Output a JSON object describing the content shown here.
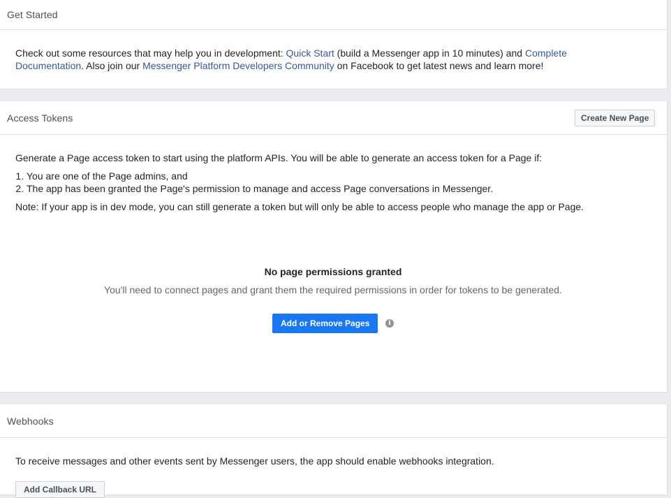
{
  "get_started": {
    "title": "Get Started",
    "text_1": "Check out some resources that may help you in development: ",
    "link_quick_start": "Quick Start",
    "text_2": " (build a Messenger app in 10 minutes) and ",
    "link_complete_line1": "Complete",
    "link_complete_line2": "Documentation",
    "text_3": ". Also join our ",
    "link_community": "Messenger Platform Developers Community",
    "text_4": " on Facebook to get latest news and learn more!"
  },
  "access_tokens": {
    "title": "Access Tokens",
    "create_page_label": "Create New Page",
    "intro": "Generate a Page access token to start using the platform APIs. You will be able to generate an access token for a Page if:",
    "steps": [
      "You are one of the Page admins, and",
      "The app has been granted the Page's permission to manage and access Page conversations in Messenger."
    ],
    "note": "Note: If your app is in dev mode, you can still generate a token but will only be able to access people who manage the app or Page.",
    "empty_title": "No page permissions granted",
    "empty_subtitle": "You'll need to connect pages and grant them the required permissions in order for tokens to be generated.",
    "add_pages_label": "Add or Remove Pages",
    "info_icon": "info-icon",
    "info_glyph": "i"
  },
  "webhooks": {
    "title": "Webhooks",
    "text": "To receive messages and other events sent by Messenger users, the app should enable webhooks integration.",
    "add_callback_label": "Add Callback URL"
  },
  "colors": {
    "page_bg": "#e9ebee",
    "link": "#365899",
    "primary_button": "#1877f2",
    "border": "#dddfe2"
  }
}
